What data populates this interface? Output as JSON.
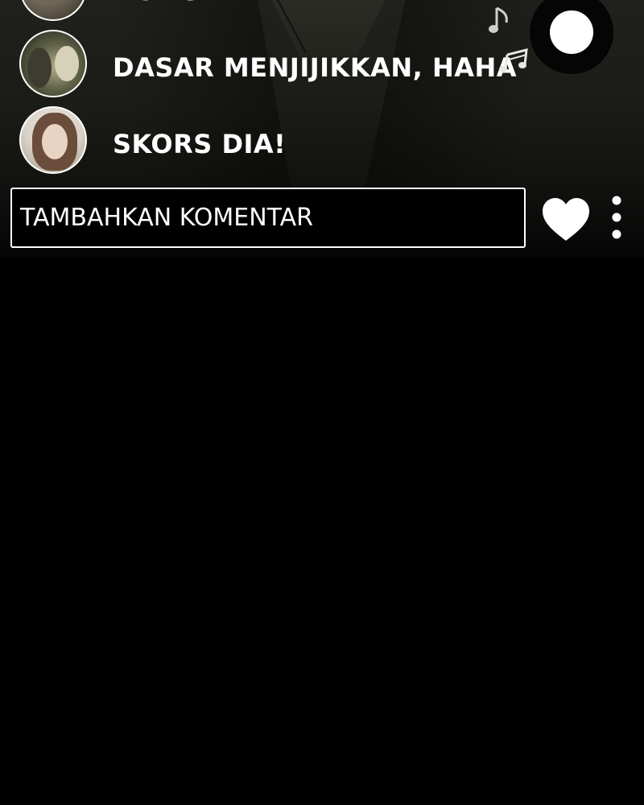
{
  "comments": [
    {
      "text": "DONG?",
      "avatar": "man-face-avatar"
    },
    {
      "text": "DASAR MENJIJIKKAN, HAHA",
      "avatar": "two-students-avatar"
    },
    {
      "text": "SKORS DIA!",
      "avatar": "woman-avatar"
    }
  ],
  "comment_input": {
    "placeholder": "TAMBAHKAN KOMENTAR"
  },
  "icons": {
    "like": "heart-icon",
    "more": "more-vertical-icon",
    "music": "music-note-icon",
    "record": "record-button"
  },
  "colors": {
    "background": "#000000",
    "text": "#ffffff"
  }
}
